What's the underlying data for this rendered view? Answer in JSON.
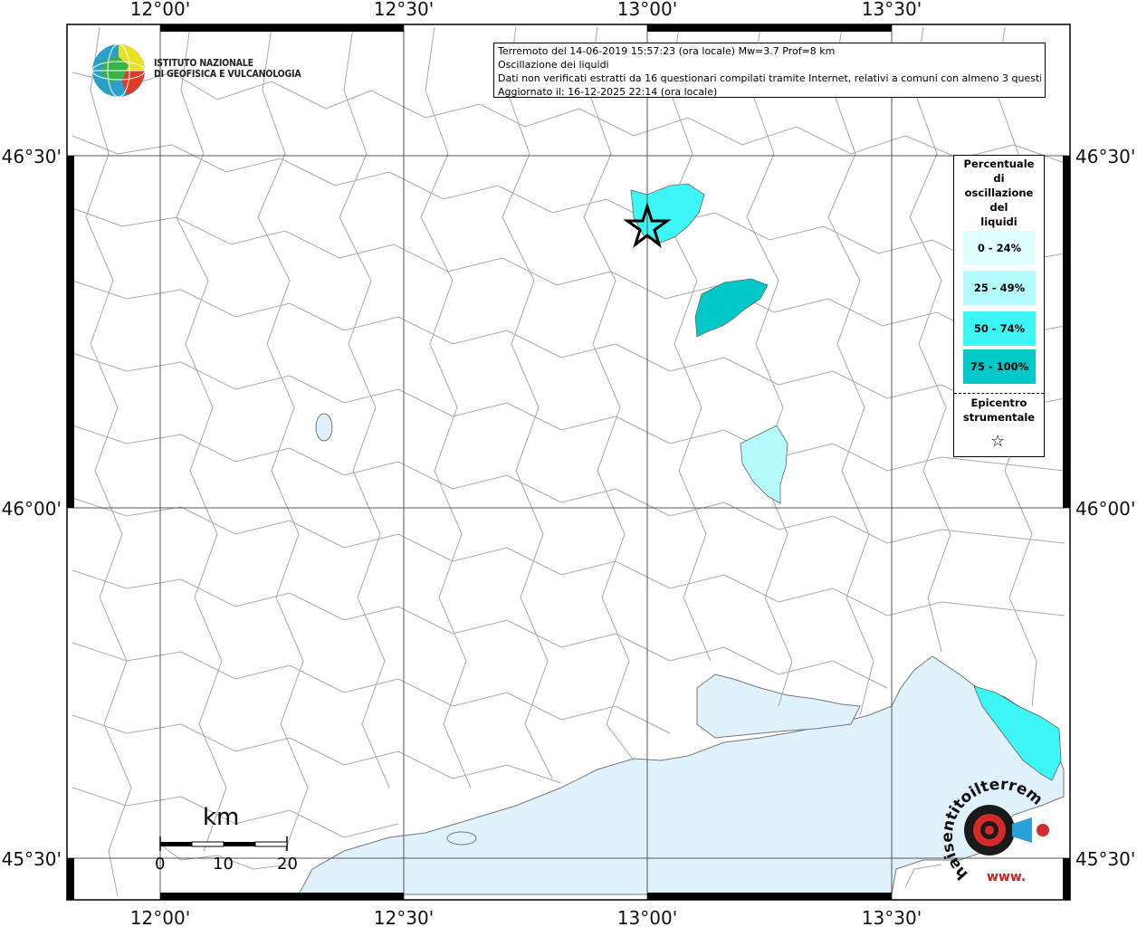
{
  "info": {
    "line1": "Terremoto del 14-06-2019 15:57:23 (ora locale) Mw=3.7 Prof=8 km",
    "line2": "Oscillazione dei liquidi",
    "line3": "Dati non verificati estratti da 16 questionari compilati tramite Internet, relativi a comuni con almeno 3 questionari.",
    "line4": "Aggiornato il: 16-12-2025 22:14 (ora locale)"
  },
  "logo": {
    "line1": "ISTITUTO NAZIONALE",
    "line2": "DI GEOFISICA E VULCANOLOGIA"
  },
  "axes": {
    "lon_ticks": [
      "12°00'",
      "12°30'",
      "13°00'",
      "13°30'"
    ],
    "lat_ticks": [
      "46°30'",
      "46°00'",
      "45°30'"
    ]
  },
  "legend": {
    "title": [
      "Percentuale",
      "di",
      "oscillazione",
      "del",
      "liquidi"
    ],
    "classes": [
      {
        "label": "0 - 24%",
        "color": "#e0ffff"
      },
      {
        "label": "25 - 49%",
        "color": "#b4fafa"
      },
      {
        "label": "50 - 74%",
        "color": "#3cf5f5"
      },
      {
        "label": "75 - 100%",
        "color": "#00c8c8"
      }
    ],
    "epicenter_line1": "Epicentro",
    "epicenter_line2": "strumentale",
    "epicenter_symbol": "☆"
  },
  "scalebar": {
    "unit": "km",
    "labels": [
      "0",
      "10",
      "20"
    ]
  },
  "watermark": {
    "text": "haisentitoilterremoto.it",
    "www": "www."
  },
  "colors": {
    "sea": "#dff1fb",
    "border": "#b0b0b0",
    "frame": "#000000"
  }
}
